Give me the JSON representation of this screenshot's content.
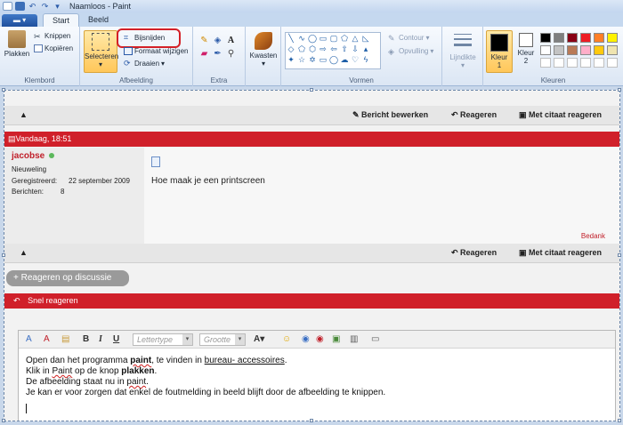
{
  "window": {
    "title": "Naamloos - Paint"
  },
  "tabs": [
    "Start",
    "Beeld"
  ],
  "ribbon": {
    "clipboard": {
      "paste": "Plakken",
      "cut": "Knippen",
      "copy": "Kopiëren",
      "label": "Klembord"
    },
    "image": {
      "select": "Selecteren",
      "crop": "Bijsnijden",
      "resize": "Formaat wijzigen",
      "rotate": "Draaien",
      "label": "Afbeelding"
    },
    "tools": {
      "label": "Extra"
    },
    "brushes": {
      "label": "Kwasten"
    },
    "shapes": {
      "outline": "Contour",
      "fill": "Opvulling",
      "label": "Vormen"
    },
    "size": {
      "label": "Lijndikte"
    },
    "colors": {
      "color1": "Kleur",
      "color1_num": "1",
      "color2": "Kleur",
      "color2_num": "2",
      "label": "Kleuren",
      "palette": [
        "#000000",
        "#7f7f7f",
        "#880015",
        "#ed1c24",
        "#ff7f27",
        "#fff200",
        "#ffffff",
        "#c3c3c3",
        "#b97a57",
        "#ffaec9",
        "#ffc90e",
        "#efe4b0",
        "#ffffff",
        "#ffffff",
        "#ffffff",
        "#ffffff",
        "#ffffff",
        "#ffffff"
      ]
    }
  },
  "forum": {
    "edit_post": "Bericht bewerken",
    "reply": "Reageren",
    "quote_reply": "Met citaat reageren",
    "post_date": "Vandaag, 18:51",
    "username": "jacobse",
    "rank": "Nieuweling",
    "registered_label": "Geregistreerd:",
    "registered_value": "22 september 2009",
    "posts_label": "Berichten:",
    "posts_value": "8",
    "post_text": "Hoe maak je een printscreen",
    "thanks": "Bedank",
    "reply_discussion": "+ Reageren op discussie",
    "quick_reply": "Snel reageren",
    "font_placeholder": "Lettertype",
    "size_placeholder": "Grootte"
  },
  "editor_lines": {
    "l1a": "Open dan het programma ",
    "l1b": "paint",
    "l1c": ", te vinden in ",
    "l1d": "bureau- accessoires",
    "l1e": ".",
    "l2a": "Klik in ",
    "l2b": "Paint",
    "l2c": " op de knop ",
    "l2d": "plakken",
    "l2e": ".",
    "l3a": "De afbeelding staat nu in ",
    "l3b": "paint",
    "l3c": ".",
    "l4": "Je kan er voor zorgen dat enkel de foutmelding in beeld blijft door de afbeelding te knippen."
  }
}
